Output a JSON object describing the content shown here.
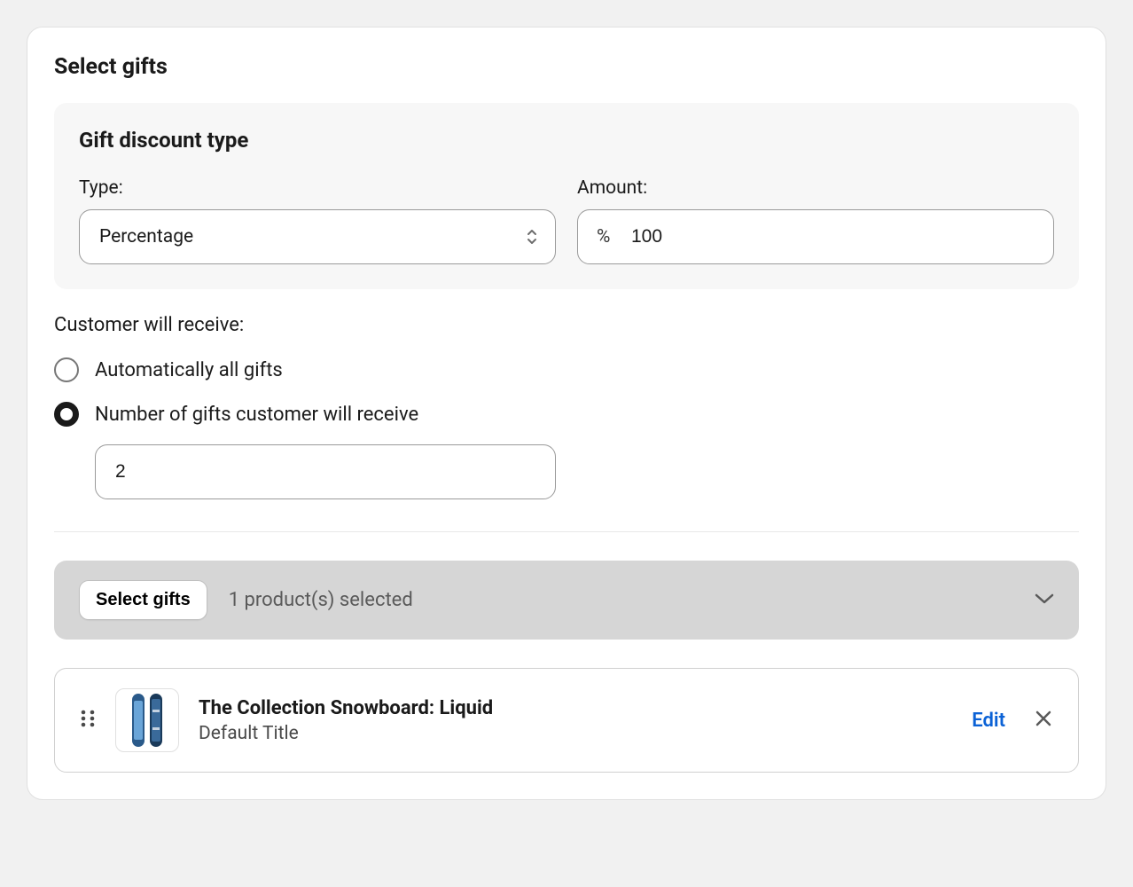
{
  "card": {
    "title": "Select gifts"
  },
  "discount": {
    "heading": "Gift discount type",
    "type_label": "Type:",
    "type_value": "Percentage",
    "amount_label": "Amount:",
    "amount_prefix": "%",
    "amount_value": "100"
  },
  "receive": {
    "label": "Customer will receive:",
    "options": [
      {
        "label": "Automatically all gifts",
        "selected": false
      },
      {
        "label": "Number of gifts customer will receive",
        "selected": true
      }
    ],
    "number_value": "2"
  },
  "selector": {
    "button_label": "Select gifts",
    "selected_text": "1 product(s) selected"
  },
  "product": {
    "name": "The Collection Snowboard: Liquid",
    "subtitle": "Default Title",
    "edit_label": "Edit"
  }
}
